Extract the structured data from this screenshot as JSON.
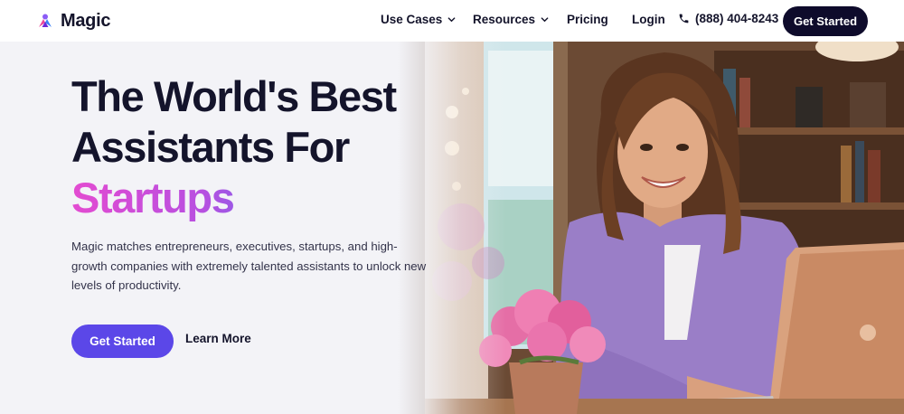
{
  "brand": {
    "name": "Magic",
    "logo_icon": "magic-logo-icon"
  },
  "nav": {
    "items": [
      {
        "label": "Use Cases",
        "dropdown": true
      },
      {
        "label": "Resources",
        "dropdown": true
      },
      {
        "label": "Pricing",
        "dropdown": false
      },
      {
        "label": "Login",
        "dropdown": false
      }
    ],
    "phone": {
      "icon": "phone-icon",
      "number": "(888) 404-8243"
    },
    "cta_label": "Get Started"
  },
  "hero": {
    "headline_line1": "The World's Best",
    "headline_line2": "Assistants For",
    "headline_accent": "Startups",
    "description": "Magic matches entrepreneurs, executives, startups, and high-growth companies with extremely talented assistants to unlock new levels of productivity.",
    "primary_button": "Get Started",
    "secondary_link": "Learn More"
  },
  "colors": {
    "dark": "#0e0b2b",
    "primary": "#5b47e8",
    "accent_gradient": [
      "#e34bd1",
      "#b84fe0",
      "#5b6df2",
      "#33a8ee"
    ],
    "hero_bg": "#f3f3f7"
  }
}
